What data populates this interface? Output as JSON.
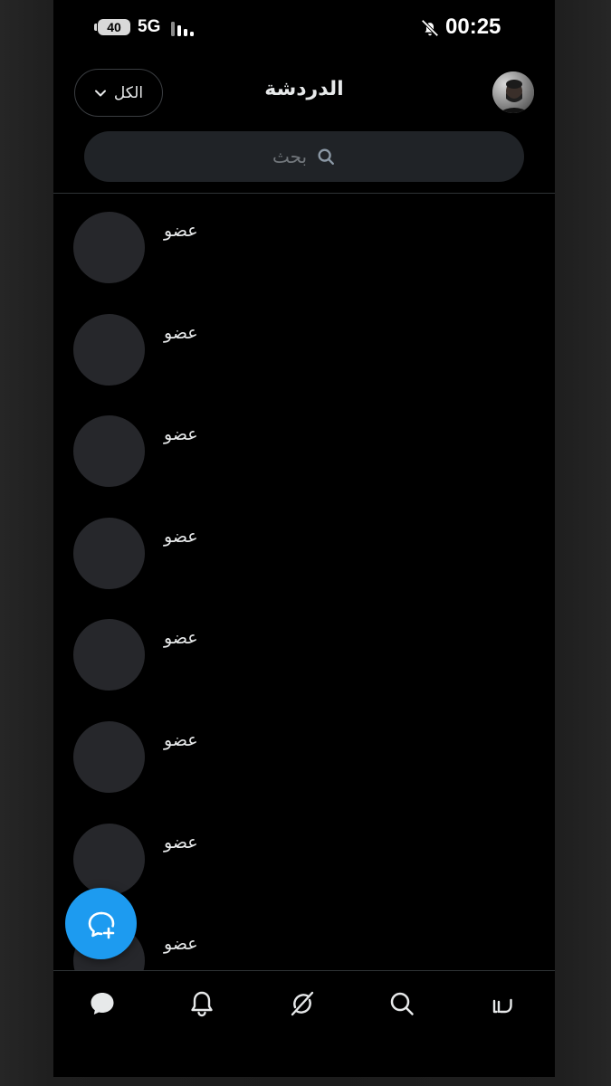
{
  "status_bar": {
    "battery": "40",
    "network": "5G",
    "time": "00:25",
    "silent_icon": "bell-slash-icon"
  },
  "header": {
    "filter_label": "الكل",
    "title": "الدردشة",
    "avatar_icon": "profile-avatar"
  },
  "search": {
    "placeholder": "بحث"
  },
  "chats": [
    {
      "name": "عضو"
    },
    {
      "name": "عضو"
    },
    {
      "name": "عضو"
    },
    {
      "name": "عضو"
    },
    {
      "name": "عضو"
    },
    {
      "name": "عضو"
    },
    {
      "name": "عضو"
    },
    {
      "name": "عضو"
    }
  ],
  "fab": {
    "icon": "new-message-icon"
  },
  "bottom_nav": [
    {
      "icon": "messages-icon",
      "active": true
    },
    {
      "icon": "notifications-icon",
      "active": false
    },
    {
      "icon": "grok-icon",
      "active": false
    },
    {
      "icon": "search-icon",
      "active": false
    },
    {
      "icon": "home-icon",
      "active": false
    }
  ],
  "colors": {
    "accent": "#1d9bf0",
    "background": "#000000",
    "text": "#e7e9ea",
    "muted": "#71767b"
  }
}
